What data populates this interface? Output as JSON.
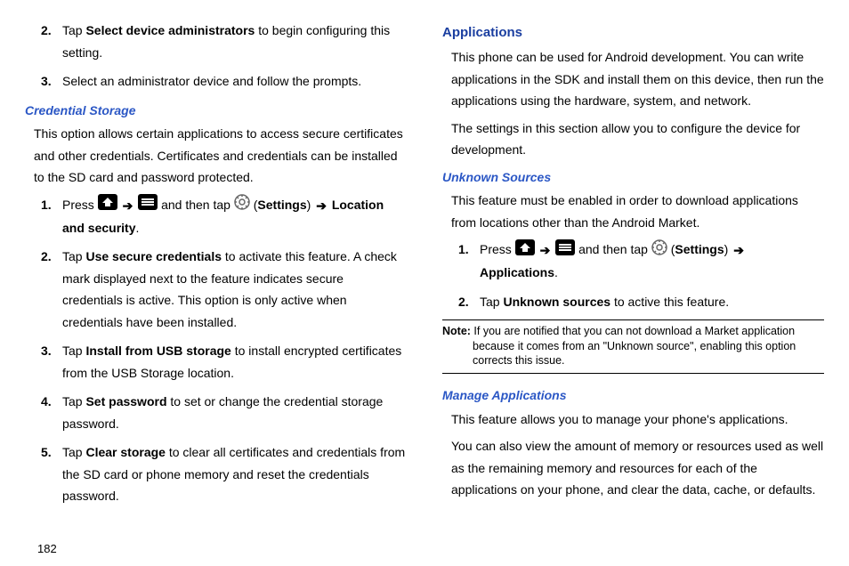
{
  "pageNumber": "182",
  "left": {
    "steps_a": [
      {
        "num": "2.",
        "pre": "Tap ",
        "bold": "Select device administrators",
        "post": " to begin configuring this setting."
      },
      {
        "num": "3.",
        "pre": "Select an administrator device and follow the prompts.",
        "bold": "",
        "post": ""
      }
    ],
    "h2_cred": "Credential Storage",
    "cred_para": "This option allows certain applications to access secure certificates and other credentials. Certificates and credentials can be installed to the SD card and password protected.",
    "cred_steps": {
      "s1": {
        "num": "1.",
        "press": "Press ",
        "andthen": " and then tap ",
        "settings_open": " (",
        "settings_bold": "Settings",
        "settings_close": ") ",
        "arrow2": "",
        "loc_bold": "Location and security",
        "loc_end": "."
      },
      "s2": {
        "num": "2.",
        "pre": "Tap ",
        "bold": "Use secure credentials",
        "post": " to activate this feature. A check mark displayed next to the feature indicates secure credentials is active. This option is only active when credentials have been installed."
      },
      "s3": {
        "num": "3.",
        "pre": "Tap ",
        "bold": "Install from USB storage",
        "post": " to install encrypted certificates from the USB Storage location."
      },
      "s4": {
        "num": "4.",
        "pre": "Tap ",
        "bold": "Set password",
        "post": " to set or change the credential storage password."
      },
      "s5": {
        "num": "5.",
        "pre": "Tap ",
        "bold": "Clear storage",
        "post": " to clear all certificates and credentials from the SD card or phone memory and reset the credentials password."
      }
    }
  },
  "right": {
    "h1_apps": "Applications",
    "apps_p1": "This phone can be used for Android development. You can write applications in the SDK and install them on this device, then run the applications using the hardware, system, and network.",
    "apps_p2": "The settings in this section allow you to configure the device for development.",
    "h2_unknown": "Unknown Sources",
    "unknown_p": "This feature must be enabled in order to download applications from locations other than the Android Market.",
    "unknown_steps": {
      "s1": {
        "num": "1.",
        "press": "Press ",
        "andthen": " and then tap ",
        "settings_open": " (",
        "settings_bold": "Settings",
        "settings_close": ") ",
        "apps_bold": "Applications",
        "apps_end": "."
      },
      "s2": {
        "num": "2.",
        "pre": "Tap ",
        "bold": "Unknown sources",
        "post": " to active this feature."
      }
    },
    "note_label": "Note:",
    "note_text": " If you are notified that you can not download a Market application because it comes from an \"Unknown source\", enabling this option corrects this issue.",
    "h2_manage": "Manage Applications",
    "manage_p1": "This feature allows you to manage your phone's applications.",
    "manage_p2": "You can also view the amount of memory or resources used as well as the remaining memory and resources for each of the applications on your phone, and clear the data, cache, or defaults."
  },
  "icons": {
    "arrow": "➔"
  }
}
